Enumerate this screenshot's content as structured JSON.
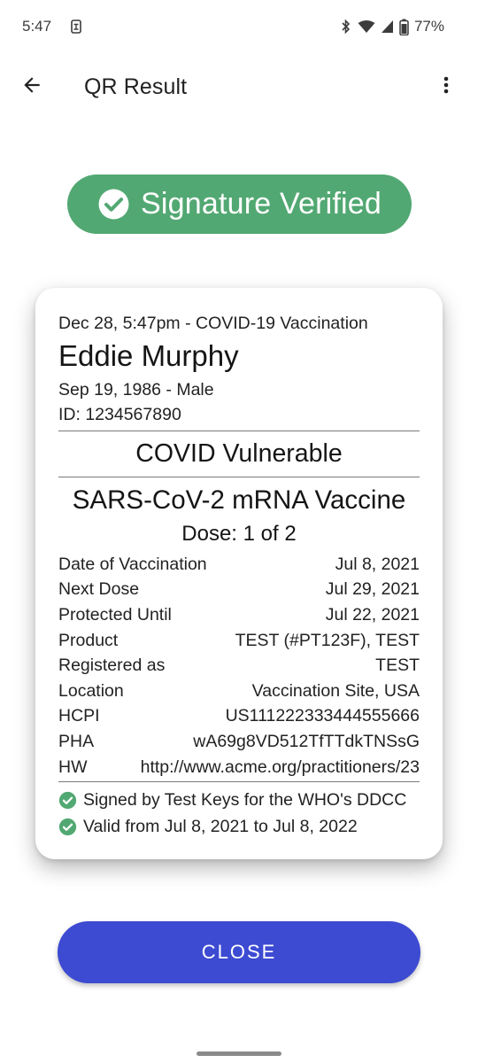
{
  "status_bar": {
    "time": "5:47",
    "battery": "77%",
    "icons": [
      "bluetooth-icon",
      "wifi-icon",
      "cell-signal-icon",
      "battery-icon"
    ]
  },
  "app_bar": {
    "title": "QR Result",
    "back_icon": "arrow-back-icon",
    "menu_icon": "more-vert-icon"
  },
  "signature_badge": {
    "text": "Signature Verified",
    "icon": "check-circle-icon",
    "color": "#52a872"
  },
  "card": {
    "subtitle": "Dec 28, 5:47pm - COVID-19 Vaccination",
    "name": "Eddie Murphy",
    "dob_gender": "Sep 19, 1986 - Male",
    "id": "ID: 1234567890",
    "category": "COVID Vulnerable",
    "vaccine": "SARS-CoV-2 mRNA Vaccine",
    "dose": "Dose: 1 of 2",
    "details": [
      {
        "label": "Date of Vaccination",
        "value": "Jul 8, 2021"
      },
      {
        "label": "Next Dose",
        "value": "Jul 29, 2021"
      },
      {
        "label": "Protected Until",
        "value": "Jul 22, 2021"
      },
      {
        "label": "Product",
        "value": "TEST (#PT123F), TEST"
      },
      {
        "label": "Registered as",
        "value": "TEST"
      },
      {
        "label": "Location",
        "value": "Vaccination Site, USA"
      },
      {
        "label": "HCPI",
        "value": "US111222333444555666"
      },
      {
        "label": "PHA",
        "value": "wA69g8VD512TfTTdkTNSsG"
      },
      {
        "label": "HW",
        "value": "http://www.acme.org/practitioners/23"
      }
    ],
    "verifications": [
      {
        "text": "Signed by Test Keys for the WHO's DDCC",
        "icon": "check-circle-icon"
      },
      {
        "text": "Valid from Jul 8, 2021 to Jul 8, 2022",
        "icon": "check-circle-icon"
      }
    ]
  },
  "close_button": {
    "label": "CLOSE",
    "color": "#3d4ad2"
  }
}
